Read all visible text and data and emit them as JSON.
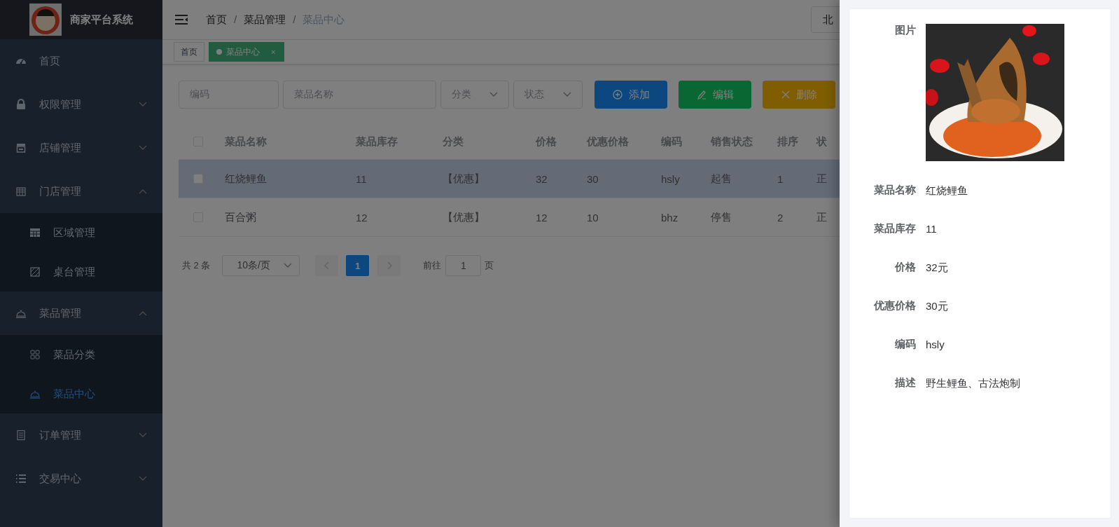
{
  "app": {
    "title": "商家平台系统"
  },
  "sidebar": {
    "items": [
      {
        "label": "首页"
      },
      {
        "label": "权限管理",
        "expanded": false
      },
      {
        "label": "店铺管理",
        "expanded": false
      },
      {
        "label": "门店管理",
        "expanded": true,
        "children": [
          {
            "label": "区域管理",
            "selected": false
          },
          {
            "label": "桌台管理",
            "selected": false
          }
        ]
      },
      {
        "label": "菜品管理",
        "expanded": true,
        "children": [
          {
            "label": "菜品分类",
            "selected": false
          },
          {
            "label": "菜品中心",
            "selected": true
          }
        ]
      },
      {
        "label": "订单管理",
        "expanded": false
      },
      {
        "label": "交易中心",
        "expanded": false
      }
    ]
  },
  "breadcrumb": {
    "separator": "/",
    "items": [
      "首页",
      "菜品管理",
      "菜品中心"
    ]
  },
  "header_select": {
    "value": "北"
  },
  "tags": [
    {
      "label": "首页",
      "selected": false
    },
    {
      "label": "菜品中心",
      "selected": true,
      "close": "×"
    }
  ],
  "filters": [
    {
      "kind": "input",
      "placeholder": "编码"
    },
    {
      "kind": "input",
      "placeholder": "菜品名称"
    },
    {
      "kind": "select",
      "placeholder": "分类"
    },
    {
      "kind": "select",
      "placeholder": "状态"
    }
  ],
  "actions": [
    {
      "label": "添加",
      "kind": "add"
    },
    {
      "label": "编辑",
      "kind": "edit"
    },
    {
      "label": "删除",
      "kind": "delete"
    }
  ],
  "table": {
    "header_checked": false,
    "columns": [
      "菜品名称",
      "菜品库存",
      "分类",
      "价格",
      "优惠价格",
      "编码",
      "销售状态",
      "排序",
      "状"
    ],
    "rows": [
      {
        "selected": true,
        "checked": false,
        "cells": [
          "红烧鲤鱼",
          "11",
          "【优惠】",
          "32",
          "30",
          "hsly",
          "起售",
          "1",
          "正"
        ]
      },
      {
        "selected": false,
        "checked": false,
        "cells": [
          "百合粥",
          "12",
          "【优惠】",
          "12",
          "10",
          "bhz",
          "停售",
          "2",
          "正"
        ]
      }
    ]
  },
  "pagination": {
    "total": "共 2 条",
    "page_size": "10条/页",
    "pages": [
      {
        "label": "1",
        "selected": true
      }
    ],
    "goto_label": "前往",
    "goto_value": "1",
    "goto_suffix": "页"
  },
  "drawer": {
    "image_label": "图片",
    "fields": [
      {
        "label": "菜品名称",
        "value": "红烧鲤鱼"
      },
      {
        "label": "菜品库存",
        "value": "11"
      },
      {
        "label": "价格",
        "value": "32元"
      },
      {
        "label": "优惠价格",
        "value": "30元"
      },
      {
        "label": "编码",
        "value": "hsly"
      },
      {
        "label": "描述",
        "value": "野生鲤鱼、古法炮制"
      }
    ]
  }
}
